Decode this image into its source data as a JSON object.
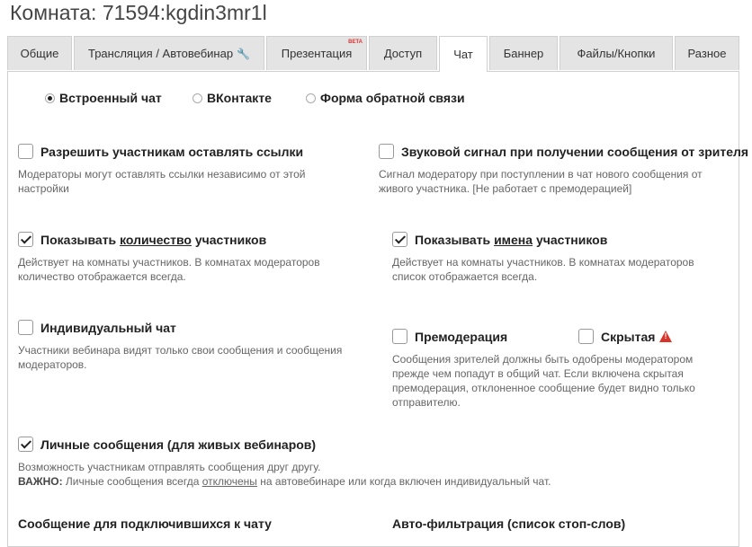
{
  "title": "Комната: 71594:kgdin3mr1l",
  "tabs": [
    {
      "label": "Общие"
    },
    {
      "label": "Трансляция / Автовебинар"
    },
    {
      "label": "Презентация",
      "badge": "BETA"
    },
    {
      "label": "Доступ"
    },
    {
      "label": "Чат"
    },
    {
      "label": "Баннер"
    },
    {
      "label": "Файлы/Кнопки"
    },
    {
      "label": "Разное"
    }
  ],
  "chat_type": {
    "options": [
      "Встроенный чат",
      "ВКонтакте",
      "Форма обратной связи"
    ],
    "selected": "Встроенный чат"
  },
  "settings": {
    "allow_links": {
      "label": "Разрешить участникам оставлять ссылки",
      "checked": false,
      "desc": "Модераторы могут оставлять ссылки независимо от этой настройки"
    },
    "sound": {
      "label": "Звуковой сигнал при получении сообщения от зрителя",
      "checked": false,
      "desc": "Сигнал модератору при поступлении в чат нового сообщения от живого участника. [Не работает с премодерацией]"
    },
    "show_count": {
      "pre": "Показывать",
      "u": "количество",
      "post": "участников",
      "checked": true,
      "desc": "Действует на комнаты участников. В комнатах модераторов количество отображается всегда."
    },
    "show_names": {
      "pre": "Показывать",
      "u": "имена",
      "post": "участников",
      "checked": true,
      "desc": "Действует на комнаты участников. В комнатах модераторов список отображается всегда."
    },
    "individual": {
      "label": "Индивидуальный чат",
      "checked": false,
      "desc": "Участники вебинара видят только свои сообщения и сообщения модераторов."
    },
    "premoderation": {
      "label": "Премодерация",
      "checked": false
    },
    "hidden": {
      "label": "Скрытая",
      "checked": false,
      "warn_icon": "warning-icon"
    },
    "premod_desc": "Сообщения зрителей должны быть одобрены модератором прежде чем попадут в общий чат. Если включена скрытая премодерация, отклоненное сообщение будет видно только отправителю.",
    "private_msgs": {
      "label": "Личные сообщения (для живых вебинаров)",
      "checked": true,
      "desc": "Возможность участникам отправлять сообщения друг другу.",
      "important_label": "ВАЖНО:",
      "important_pre": "Личные сообщения всегда",
      "important_u": "отключены",
      "important_post": "на автовебинаре или когда включен индивидуальный чат."
    }
  },
  "sections": {
    "welcome": "Сообщение для подключившихся к чату",
    "filter": "Авто-фильтрация (список стоп-слов)"
  }
}
